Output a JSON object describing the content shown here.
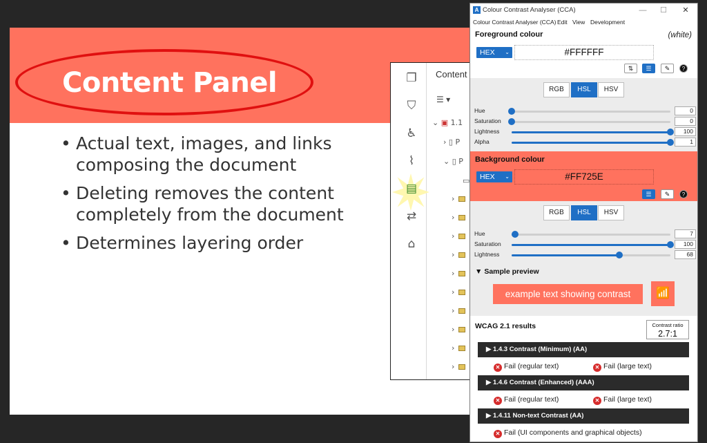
{
  "slide": {
    "title": "Content Panel",
    "bullets": [
      "Actual text, images, and links composing the document",
      "Deleting removes the content completely from the document",
      "Determines layering order"
    ],
    "bullet_glyph": "•",
    "accent_color": "#FF725E",
    "highlight_color": "#E01010"
  },
  "acrobat": {
    "panel_title": "Content",
    "tree_top_label": "1.1",
    "tree_child_label": "P",
    "rail_icons": [
      "pages-icon",
      "bookmark-icon",
      "accessibility-icon",
      "attachment-icon",
      "content-icon",
      "compare-icon",
      "tags-icon"
    ]
  },
  "cca": {
    "window_title": "Colour Contrast Analyser (CCA)",
    "menu": [
      "Colour Contrast Analyser (CCA)",
      "Edit",
      "View",
      "Development"
    ],
    "foreground": {
      "title": "Foreground colour",
      "name_hint": "(white)",
      "format": "HEX",
      "value": "#FFFFFF",
      "modes": [
        "RGB",
        "HSL",
        "HSV"
      ],
      "active_mode": "HSL",
      "sliders": [
        {
          "label": "Hue",
          "value": "0",
          "fraction": 0.0
        },
        {
          "label": "Saturation",
          "value": "0",
          "fraction": 0.0
        },
        {
          "label": "Lightness",
          "value": "100",
          "fraction": 1.0
        },
        {
          "label": "Alpha",
          "value": "1",
          "fraction": 1.0
        }
      ]
    },
    "background": {
      "title": "Background colour",
      "format": "HEX",
      "value": "#FF725E",
      "modes": [
        "RGB",
        "HSL",
        "HSV"
      ],
      "active_mode": "HSL",
      "sliders": [
        {
          "label": "Hue",
          "value": "7",
          "fraction": 0.02
        },
        {
          "label": "Saturation",
          "value": "100",
          "fraction": 1.0
        },
        {
          "label": "Lightness",
          "value": "68",
          "fraction": 0.68
        }
      ]
    },
    "preview": {
      "title": "Sample preview",
      "sample_text": "example text showing contrast",
      "collapse_glyph": "▼"
    },
    "wcag": {
      "title": "WCAG 2.1 results",
      "ratio_label": "Contrast ratio",
      "ratio_value": "2.7:1",
      "expand_glyph": "▶",
      "criteria": [
        {
          "name": "1.4.3 Contrast (Minimum) (AA)",
          "results": [
            "Fail (regular text)",
            "Fail (large text)"
          ]
        },
        {
          "name": "1.4.6 Contrast (Enhanced) (AAA)",
          "results": [
            "Fail (regular text)",
            "Fail (large text)"
          ]
        },
        {
          "name": "1.4.11 Non-text Contrast (AA)",
          "results": [
            "Fail (UI components and graphical objects)"
          ]
        }
      ]
    },
    "primary_color": "#1F6FC5",
    "fail_color": "#D62C2C"
  }
}
